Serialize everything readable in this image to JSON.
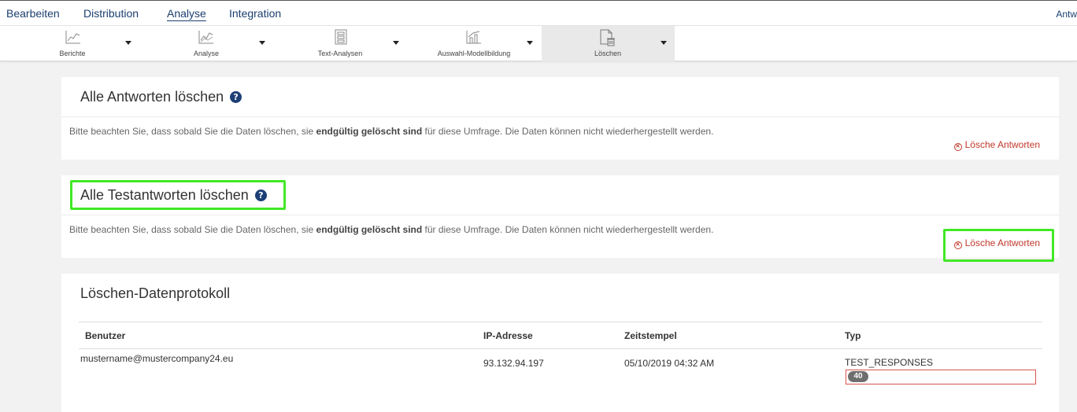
{
  "topnav": {
    "items": [
      "Bearbeiten",
      "Distribution",
      "Analyse",
      "Integration"
    ],
    "active": "Analyse",
    "right_label": "Antw"
  },
  "toolbar": {
    "tools": [
      {
        "label": "Berichte",
        "icon": "line-chart-icon"
      },
      {
        "label": "Analyse",
        "icon": "trend-chart-icon"
      },
      {
        "label": "Text-Analysen",
        "icon": "document-grid-icon"
      },
      {
        "label": "Auswahl-Modellbildung",
        "icon": "bar-trend-icon"
      },
      {
        "label": "Löschen",
        "icon": "trash-document-icon"
      }
    ],
    "active": "Löschen"
  },
  "panel_all": {
    "title": "Alle Antworten löschen",
    "help": "?",
    "note_pre": "Bitte beachten Sie, dass sobald Sie die Daten löschen, sie ",
    "note_bold": "endgültig gelöscht sind",
    "note_post": " für diese Umfrage. Die Daten können nicht wiederhergestellt werden.",
    "delete_label": "Lösche Antworten"
  },
  "panel_test": {
    "title": "Alle Testantworten löschen",
    "help": "?",
    "note_pre": "Bitte beachten Sie, dass sobald Sie die Daten löschen, sie ",
    "note_bold": "endgültig gelöscht sind",
    "note_post": " für diese Umfrage. Die Daten können nicht wiederhergestellt werden.",
    "delete_label": "Lösche Antworten"
  },
  "log": {
    "title": "Löschen-Datenprotokoll",
    "columns": [
      "Benutzer",
      "IP-Adresse",
      "Zeitstempel",
      "Typ"
    ],
    "rows": [
      {
        "user": "mustername@mustercompany24.eu",
        "ip": "93.132.94.197",
        "time": "05/10/2019 04:32 AM",
        "type": "TEST_RESPONSES",
        "count": "40"
      }
    ]
  },
  "colors": {
    "accent": "#1a3e6e",
    "danger": "#c0392b",
    "highlight": "#42e826"
  }
}
